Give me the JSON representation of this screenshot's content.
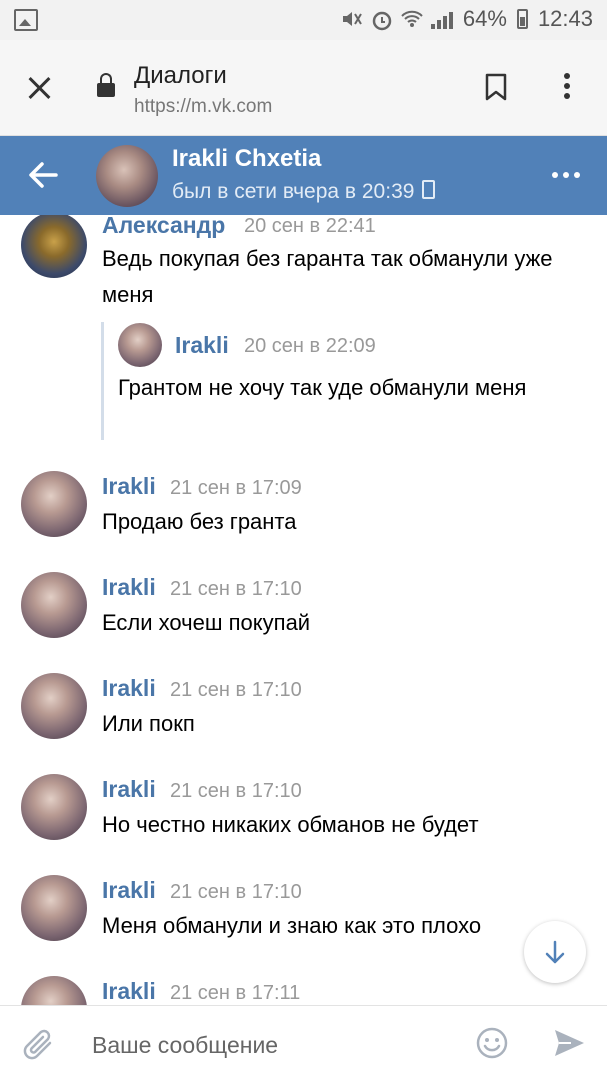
{
  "status_bar": {
    "battery": "64%",
    "time": "12:43"
  },
  "browser": {
    "title": "Диалоги",
    "url": "https://m.vk.com"
  },
  "header": {
    "name": "Irakli Chxetia",
    "status": "был в сети вчера в 20:39"
  },
  "messages": [
    {
      "author": "Александр",
      "time": "20 сен в 22:41",
      "text": "Ведь покупая без гаранта так обманули уже меня",
      "reply": {
        "author": "Irakli",
        "time": "20 сен в 22:09",
        "text": "Грантом не хочу так уде обманули меня"
      }
    },
    {
      "author": "Irakli",
      "time": "21 сен в 17:09",
      "text": "Продаю без гранта"
    },
    {
      "author": "Irakli",
      "time": "21 сен в 17:10",
      "text": "Если хочеш покупай"
    },
    {
      "author": "Irakli",
      "time": "21 сен в 17:10",
      "text": "Или покп"
    },
    {
      "author": "Irakli",
      "time": "21 сен в 17:10",
      "text": "Но честно никаких обманов не будет"
    },
    {
      "author": "Irakli",
      "time": "21 сен в 17:10",
      "text": "Меня обманули и знаю как это плохо"
    },
    {
      "author": "Irakli",
      "time": "21 сен в 17:11",
      "text": ""
    }
  ],
  "composer": {
    "placeholder": "Ваше сообщение"
  },
  "colors": {
    "header_bg": "#5181b8",
    "author": "#4a76a8",
    "time": "#999999"
  }
}
